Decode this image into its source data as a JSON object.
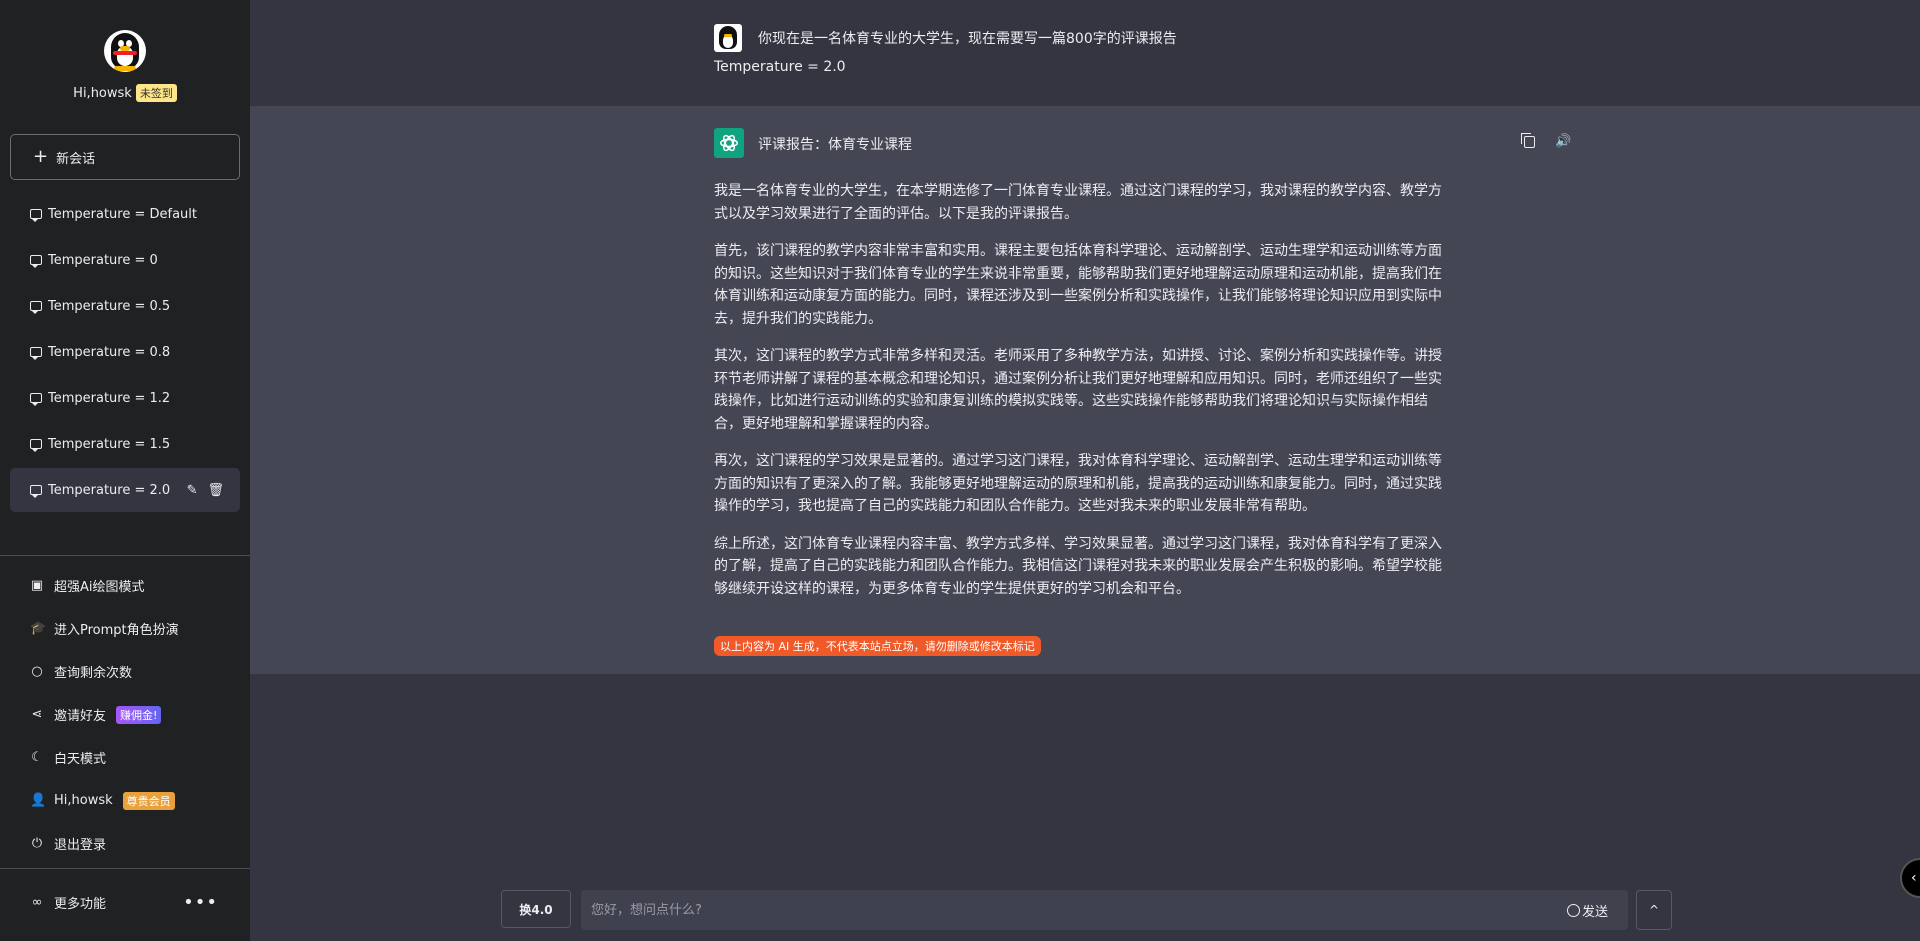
{
  "sidebar": {
    "greeting": "Hi,howsk",
    "status_badge": "未签到",
    "new_chat_label": "新会话",
    "conversations": [
      {
        "label": "Temperature = Default"
      },
      {
        "label": "Temperature = 0"
      },
      {
        "label": "Temperature = 0.5"
      },
      {
        "label": "Temperature = 0.8"
      },
      {
        "label": "Temperature = 1.2"
      },
      {
        "label": "Temperature = 1.5"
      },
      {
        "label": "Temperature = 2.0"
      }
    ],
    "menu": {
      "draw": "超强Ai绘图模式",
      "prompt": "进入Prompt角色扮演",
      "query": "查询剩余次数",
      "invite": "邀请好友",
      "invite_badge": "赚佣金!",
      "daymode": "白天模式",
      "user": "Hi,howsk",
      "vip_badge": "尊贵会员",
      "logout": "退出登录"
    },
    "more_label": "更多功能"
  },
  "chat": {
    "user_prompt": "你现在是一名体育专业的大学生，现在需要写一篇800字的评课报告",
    "user_sub": "Temperature = 2.0",
    "ai_title": "评课报告：体育专业课程",
    "paragraphs": [
      "我是一名体育专业的大学生，在本学期选修了一门体育专业课程。通过这门课程的学习，我对课程的教学内容、教学方式以及学习效果进行了全面的评估。以下是我的评课报告。",
      "首先，该门课程的教学内容非常丰富和实用。课程主要包括体育科学理论、运动解剖学、运动生理学和运动训练等方面的知识。这些知识对于我们体育专业的学生来说非常重要，能够帮助我们更好地理解运动原理和运动机能，提高我们在体育训练和运动康复方面的能力。同时，课程还涉及到一些案例分析和实践操作，让我们能够将理论知识应用到实际中去，提升我们的实践能力。",
      "其次，这门课程的教学方式非常多样和灵活。老师采用了多种教学方法，如讲授、讨论、案例分析和实践操作等。讲授环节老师讲解了课程的基本概念和理论知识，通过案例分析让我们更好地理解和应用知识。同时，老师还组织了一些实践操作，比如进行运动训练的实验和康复训练的模拟实践等。这些实践操作能够帮助我们将理论知识与实际操作相结合，更好地理解和掌握课程的内容。",
      "再次，这门课程的学习效果是显著的。通过学习这门课程，我对体育科学理论、运动解剖学、运动生理学和运动训练等方面的知识有了更深入的了解。我能够更好地理解运动的原理和机能，提高我的运动训练和康复能力。同时，通过实践操作的学习，我也提高了自己的实践能力和团队合作能力。这些对我未来的职业发展非常有帮助。",
      "综上所述，这门体育专业课程内容丰富、教学方式多样、学习效果显著。通过学习这门课程，我对体育科学有了更深入的了解，提高了自己的实践能力和团队合作能力。我相信这门课程对我未来的职业发展会产生积极的影响。希望学校能够继续开设这样的课程，为更多体育专业的学生提供更好的学习机会和平台。"
    ],
    "disclaimer": "以上内容为 AI 生成，不代表本站点立场，请勿删除或修改本标记"
  },
  "input": {
    "model_label": "换4.0",
    "placeholder": "您好，想问点什么?",
    "send_label": "发送"
  },
  "icons": {
    "accent": "#10a37f",
    "disclaimer_color": "#f05a28"
  }
}
